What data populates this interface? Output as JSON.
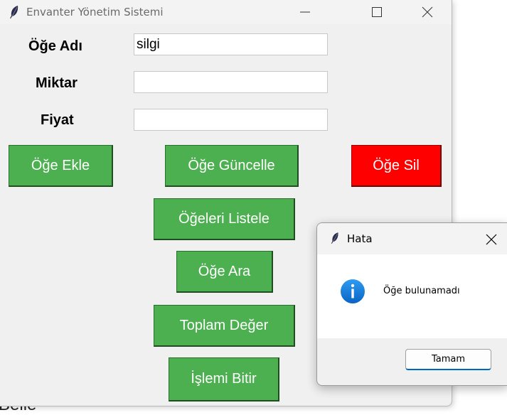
{
  "background": {
    "partial_text": "Belle"
  },
  "window": {
    "title": "Envanter Yönetim Sistemi",
    "controls": {
      "minimize": "minimize-icon",
      "maximize": "maximize-icon",
      "close": "close-icon"
    }
  },
  "form": {
    "item_name_label": "Öğe Adı",
    "item_name_value": "silgi",
    "quantity_label": "Miktar",
    "quantity_value": "",
    "price_label": "Fiyat",
    "price_value": ""
  },
  "buttons": {
    "add": "Öğe Ekle",
    "update": "Öğe Güncelle",
    "delete": "Öğe Sil",
    "list": "Öğeleri Listele",
    "search": "Öğe Ara",
    "total": "Toplam Değer",
    "finish": "İşlemi Bitir"
  },
  "colors": {
    "green": "#4caf50",
    "red": "#ff0000",
    "accent": "#0067c0"
  },
  "dialog": {
    "title": "Hata",
    "message": "Öğe bulunamadı",
    "ok": "Tamam",
    "icon": "info-icon"
  }
}
